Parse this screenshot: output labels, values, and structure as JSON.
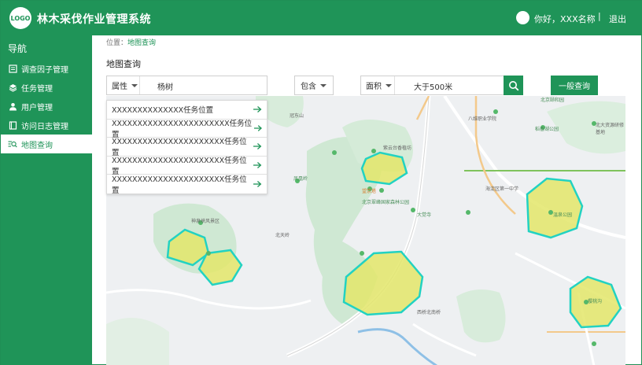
{
  "header": {
    "logo": "LOGO",
    "title": "林木采伐作业管理系统",
    "greeting": "你好，XXX名称",
    "separator": "|",
    "logout": "退出"
  },
  "sidebar": {
    "title": "导航",
    "items": [
      {
        "label": "调查因子管理",
        "icon": "list-icon"
      },
      {
        "label": "任务管理",
        "icon": "layers-icon"
      },
      {
        "label": "用户管理",
        "icon": "user-icon"
      },
      {
        "label": "访问日志管理",
        "icon": "log-icon"
      },
      {
        "label": "地图查询",
        "icon": "map-search-icon",
        "active": true
      }
    ]
  },
  "breadcrumb": {
    "prefix": "位置：",
    "current": "地图查询"
  },
  "page_title": "地图查询",
  "filters": {
    "attribute_label": "属性",
    "attribute_value": "杨树",
    "operator": "包含",
    "area_label": "面积",
    "area_value": "大于500米",
    "query_button": "一般查询"
  },
  "results": [
    "XXXXXXXXXXXXXX任务位置",
    "XXXXXXXXXXXXXXXXXXXXXXX任务位置",
    "XXXXXXXXXXXXXXXXXXXXXX任务位置",
    "XXXXXXXXXXXXXXXXXXXXXX任务位置",
    "XXXXXXXXXXXXXXXXXXXXXX任务位置"
  ],
  "map": {
    "labels": [
      "冠东山",
      "紫云台香植坊",
      "望京塔",
      "北京翠峰国家森林公园",
      "大觉寺",
      "神泉峡风景区",
      "北天岭",
      "西桥北南桥",
      "温泉公园",
      "樱桃沟",
      "稻香湖公园",
      "北京颐和园",
      "八维职业学院",
      "北大资源研修基地",
      "海淀区第一中学",
      "凤凰岭"
    ],
    "colors": {
      "accent": "#1f9458",
      "polygon_fill": "#e3e66a",
      "polygon_stroke": "#22d2c2",
      "park": "#cfe8d3"
    }
  }
}
